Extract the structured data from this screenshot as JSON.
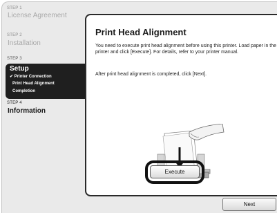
{
  "sidebar": {
    "step1_label": "STEP 1",
    "step1_title": "License Agreement",
    "step2_label": "STEP 2",
    "step2_title": "Installation",
    "step3_label": "STEP 3",
    "step3_title": "Setup",
    "step3_items": [
      {
        "label": "✔ Printer Connection"
      },
      {
        "label": "Print Head Alignment"
      },
      {
        "label": "Completion"
      }
    ],
    "step4_label": "STEP 4",
    "step4_title": "Information"
  },
  "main": {
    "title": "Print Head Alignment",
    "paragraph1": "You need to execute print head alignment before using this printer. Load paper in the printer and click [Execute]. For details, refer to your printer manual.",
    "paragraph2": "After print head alignment is completed, click [Next].",
    "execute_label": "Execute"
  },
  "footer": {
    "next_label": "Next"
  }
}
